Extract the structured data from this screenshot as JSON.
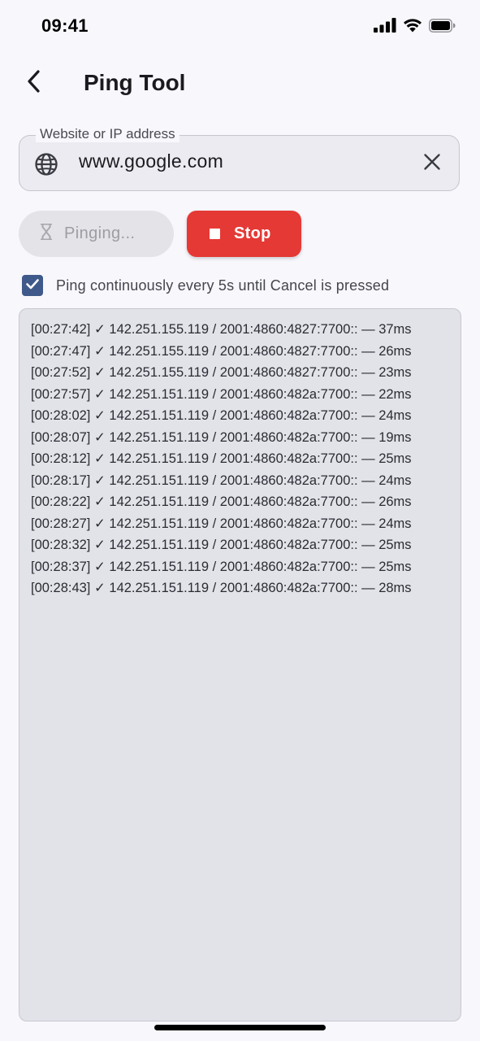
{
  "status_bar": {
    "time": "09:41"
  },
  "header": {
    "title": "Ping Tool",
    "back_icon": "chevron-left-icon"
  },
  "input": {
    "label": "Website or IP address",
    "value": "www.google.com",
    "leading_icon": "globe-icon",
    "trailing_icon": "close-icon"
  },
  "actions": {
    "pinging_label": "Pinging...",
    "pinging_icon": "hourglass-icon",
    "stop_label": "Stop",
    "stop_icon": "stop-icon",
    "stop_color": "#e53935"
  },
  "continuous": {
    "checked": true,
    "label": "Ping continuously every 5s until Cancel is pressed"
  },
  "log": [
    "[00:27:42] ✓ 142.251.155.119 / 2001:4860:4827:7700:: — 37ms",
    "[00:27:47] ✓ 142.251.155.119 / 2001:4860:4827:7700:: — 26ms",
    "[00:27:52] ✓ 142.251.155.119 / 2001:4860:4827:7700:: — 23ms",
    "[00:27:57] ✓ 142.251.151.119 / 2001:4860:482a:7700:: — 22ms",
    "[00:28:02] ✓ 142.251.151.119 / 2001:4860:482a:7700:: — 24ms",
    "[00:28:07] ✓ 142.251.151.119 / 2001:4860:482a:7700:: — 19ms",
    "[00:28:12] ✓ 142.251.151.119 / 2001:4860:482a:7700:: — 25ms",
    "[00:28:17] ✓ 142.251.151.119 / 2001:4860:482a:7700:: — 24ms",
    "[00:28:22] ✓ 142.251.151.119 / 2001:4860:482a:7700:: — 26ms",
    "[00:28:27] ✓ 142.251.151.119 / 2001:4860:482a:7700:: — 24ms",
    "[00:28:32] ✓ 142.251.151.119 / 2001:4860:482a:7700:: — 25ms",
    "[00:28:37] ✓ 142.251.151.119 / 2001:4860:482a:7700:: — 25ms",
    "[00:28:43] ✓ 142.251.151.119 / 2001:4860:482a:7700:: — 28ms"
  ]
}
